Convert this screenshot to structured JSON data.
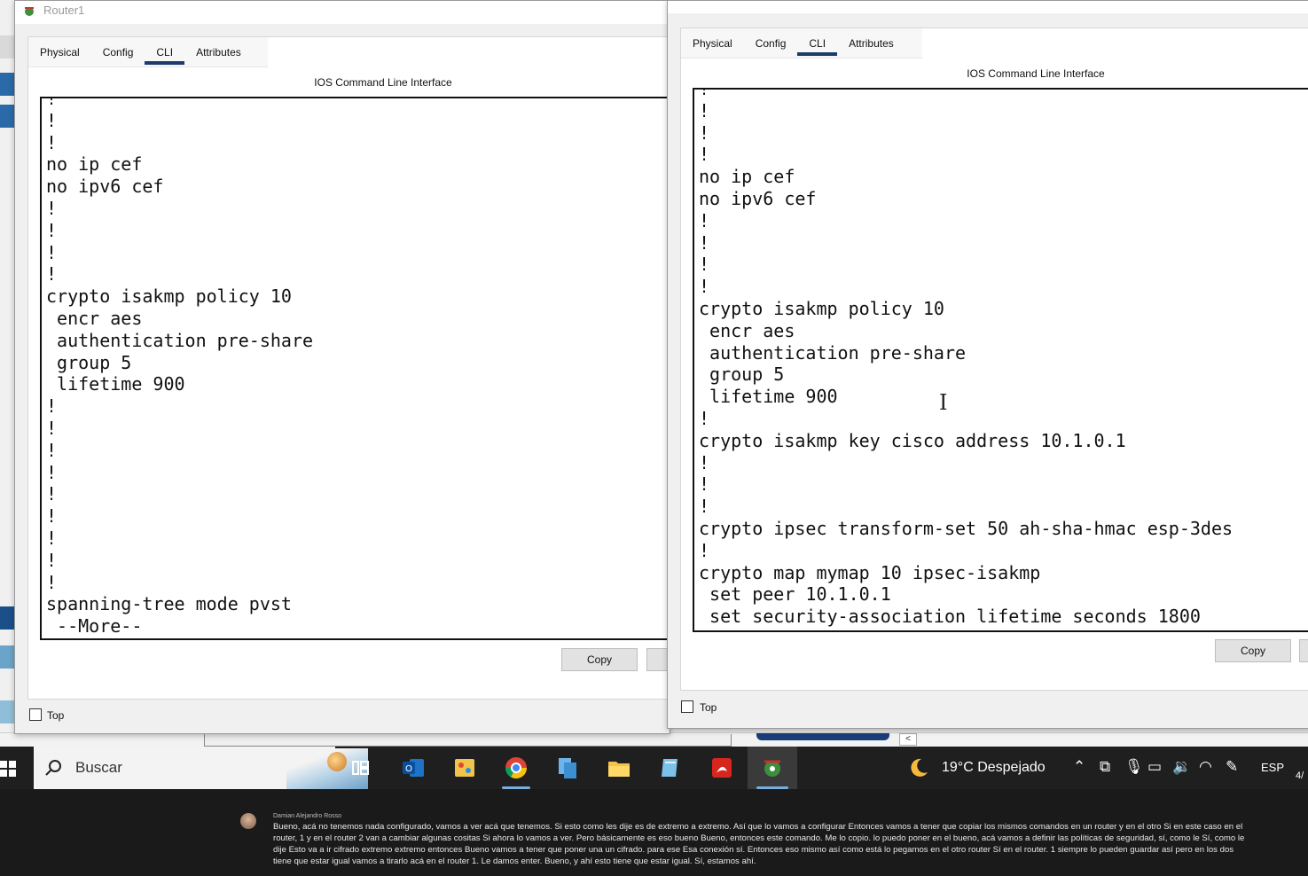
{
  "left_window": {
    "title": "Router1",
    "tabs": [
      "Physical",
      "Config",
      "CLI",
      "Attributes"
    ],
    "active_tab": "CLI",
    "cli_title": "IOS Command Line Interface",
    "terminal_text": "!\n!\n!\nno ip cef\nno ipv6 cef\n!\n!\n!\n!\ncrypto isakmp policy 10\n encr aes\n authentication pre-share\n group 5\n lifetime 900\n!\n!\n!\n!\n!\n!\n!\n!\n!\nspanning-tree mode pvst\n --More--",
    "copy_label": "Copy",
    "top_label": "Top"
  },
  "right_window": {
    "tabs": [
      "Physical",
      "Config",
      "CLI",
      "Attributes"
    ],
    "active_tab": "CLI",
    "cli_title": "IOS Command Line Interface",
    "terminal_text": "!\n!\n!\n!\nno ip cef\nno ipv6 cef\n!\n!\n!\n!\ncrypto isakmp policy 10\n encr aes\n authentication pre-share\n group 5\n lifetime 900\n!\ncrypto isakmp key cisco address 10.1.0.1\n!\n!\n!\ncrypto ipsec transform-set 50 ah-sha-hmac esp-3des\n!\ncrypto map mymap 10 ipsec-isakmp\n set peer 10.1.0.1\n set security-association lifetime seconds 1800",
    "copy_label": "Copy",
    "top_label": "Top"
  },
  "taskbar": {
    "search_label": "Buscar",
    "weather": "19°C  Despejado",
    "language": "ESP",
    "clock_fragment": "4/",
    "apps": [
      "task-view",
      "outlook",
      "paint",
      "chrome",
      "file-manager",
      "file-explorer",
      "notepad",
      "acrobat",
      "packet-tracer"
    ]
  },
  "caption": {
    "speaker": "Damian Alejandro Rosso",
    "text": "Bueno, acá no tenemos nada configurado, vamos a ver acá que tenemos. Si esto como les dije es de extremo a extremo. Así que lo vamos a configurar Entonces vamos a tener que copiar los mismos comandos en un router y en el otro Si en este caso en el router, 1 y en el router 2 van a cambiar algunas cositas Si ahora lo vamos a ver. Pero básicamente es eso bueno Bueno, entonces este comando. Me lo copio. lo puedo poner en el bueno, acá vamos a definir las políticas de seguridad, sí, como le Sí, como le dije Esto va a ir cifrado extremo extremo entonces Bueno vamos a tener que poner una un cifrado. para ese Esa conexión sí. Entonces eso mismo así como está lo pegamos en el otro router Sí en el router. 1 siempre lo pueden guardar así pero en los dos tiene que estar igual vamos a tirarlo acá en el router 1. Le damos enter. Bueno, y ahí esto tiene que estar igual. Sí, estamos ahí."
  },
  "colors": {
    "active_tab_underline": "#1b3b6b",
    "taskbar_bg": "#1f1f1f",
    "caption_bg": "#1a1a1a"
  }
}
